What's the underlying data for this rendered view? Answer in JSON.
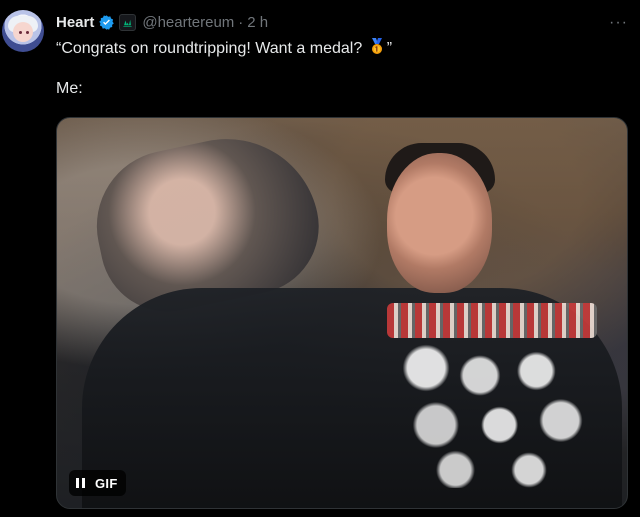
{
  "tweet": {
    "display_name": "Heart",
    "handle": "@heartereum",
    "time": "2 h",
    "separator": "·",
    "text": "“Congrats on roundtripping! Want a medal? ",
    "text_tail": "”",
    "text_line2": "Me:",
    "more_label": "···",
    "media": {
      "type": "gif",
      "badge_label": "GIF",
      "is_playing": false
    }
  },
  "colors": {
    "background": "#000000",
    "text_primary": "#e7e9ea",
    "text_secondary": "#71767b",
    "verified_blue": "#1d9bf0",
    "affiliation_green": "#00ba7c"
  },
  "icons": {
    "verified": "verified-badge-icon",
    "affiliation": "affiliation-icon",
    "medal": "medal-emoji-icon",
    "more": "more-options-icon",
    "pause": "pause-icon"
  }
}
